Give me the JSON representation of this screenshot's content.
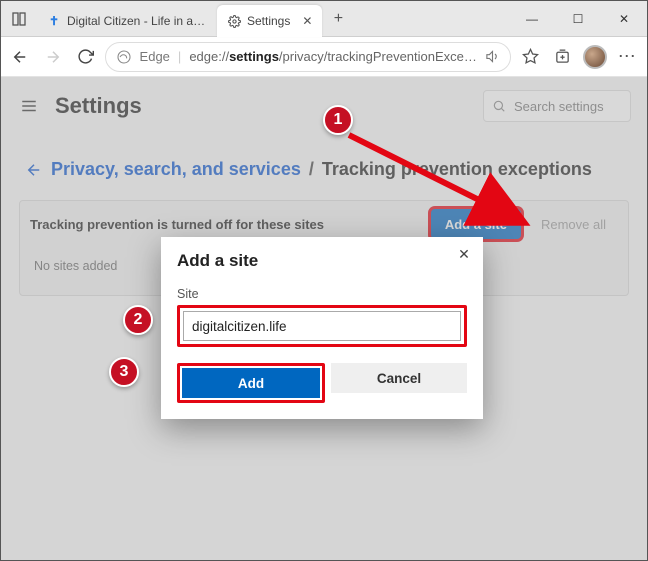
{
  "window": {
    "tab1_title": "Digital Citizen - Life in a digital w",
    "tab2_title": "Settings",
    "minimize": "—",
    "maximize": "☐",
    "close": "✕"
  },
  "toolbar": {
    "edge_label": "Edge",
    "url_prefix": "edge://",
    "url_bold": "settings",
    "url_suffix": "/privacy/trackingPreventionExce…"
  },
  "page": {
    "settings_title": "Settings",
    "search_placeholder": "Search settings",
    "breadcrumb_link": "Privacy, search, and services",
    "breadcrumb_sep": "/",
    "breadcrumb_current": "Tracking prevention exceptions",
    "section_msg": "Tracking prevention is turned off for these sites",
    "add_site_label": "Add a site",
    "remove_all_label": "Remove all",
    "no_sites_msg": "No sites added"
  },
  "dialog": {
    "title": "Add a site",
    "site_label": "Site",
    "site_value": "digitalcitizen.life",
    "add_label": "Add",
    "cancel_label": "Cancel"
  },
  "annotations": {
    "n1": "1",
    "n2": "2",
    "n3": "3"
  }
}
